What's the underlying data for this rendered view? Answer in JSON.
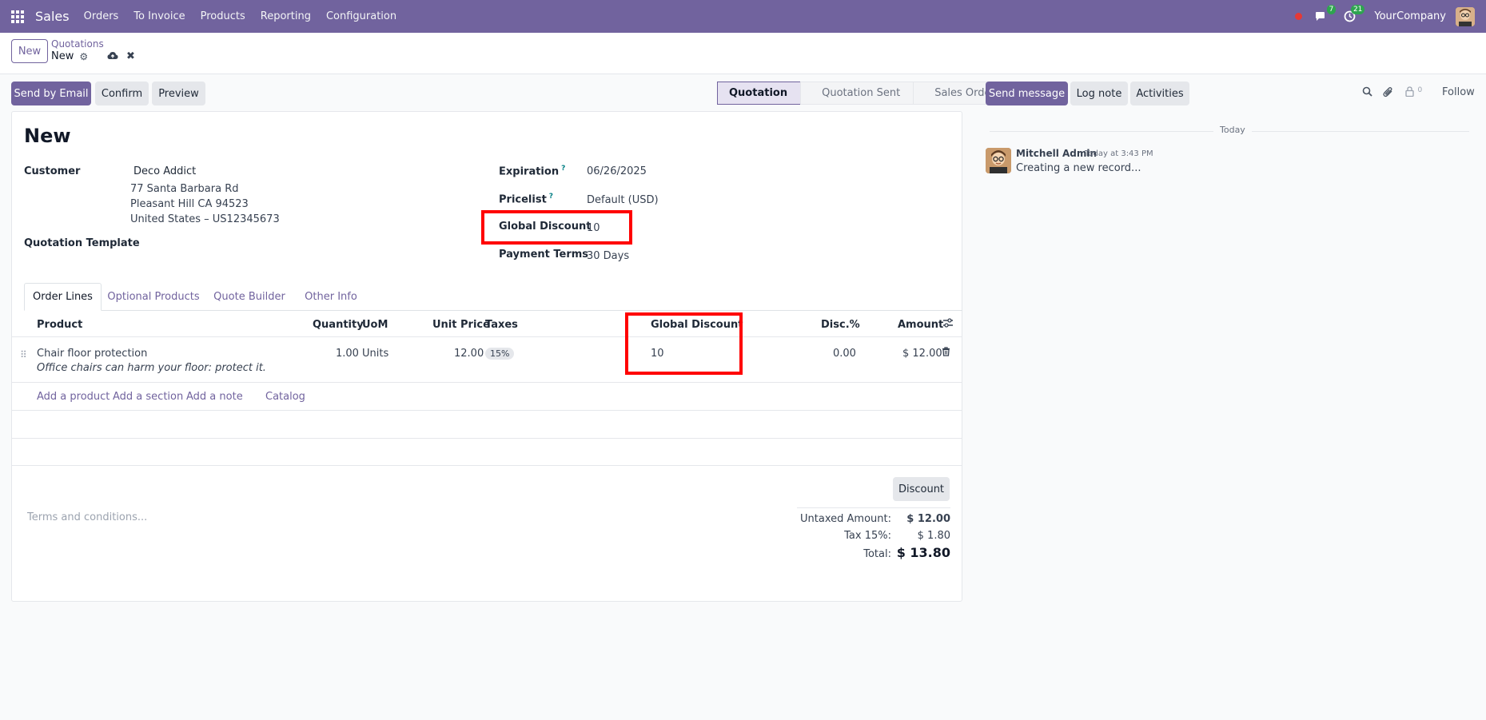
{
  "navbar": {
    "app_name": "Sales",
    "menu": [
      "Orders",
      "To Invoice",
      "Products",
      "Reporting",
      "Configuration"
    ],
    "messages_count": "7",
    "activities_count": "21",
    "company": "YourCompany",
    "color": "#71639e"
  },
  "control": {
    "new_label": "New",
    "breadcrumb_parent": "Quotations",
    "breadcrumb_current": "New"
  },
  "actions": {
    "send_email": "Send by Email",
    "confirm": "Confirm",
    "preview": "Preview"
  },
  "status": {
    "stages": [
      "Quotation",
      "Quotation Sent",
      "Sales Order"
    ],
    "active": "Quotation"
  },
  "form": {
    "title": "New",
    "customer_label": "Customer",
    "customer_name": "Deco Addict",
    "address_line1": "77 Santa Barbara Rd",
    "address_line2": "Pleasant Hill CA 94523",
    "address_line3": "United States – US12345673",
    "template_label": "Quotation Template",
    "expiration_label": "Expiration",
    "expiration_value": "06/26/2025",
    "pricelist_label": "Pricelist",
    "pricelist_value": "Default (USD)",
    "global_discount_label": "Global Discount",
    "global_discount_value": "10",
    "payment_terms_label": "Payment Terms",
    "payment_terms_value": "30 Days",
    "help_mark": "?"
  },
  "tabs": [
    "Order Lines",
    "Optional Products",
    "Quote Builder",
    "Other Info"
  ],
  "table": {
    "headers": {
      "product": "Product",
      "quantity": "Quantity",
      "uom": "UoM",
      "unit_price": "Unit Price",
      "taxes": "Taxes",
      "global_discount": "Global Discount",
      "disc": "Disc.%",
      "amount": "Amount"
    },
    "row": {
      "product": "Chair floor protection",
      "description": "Office chairs can harm your floor: protect it.",
      "quantity": "1.00",
      "uom": "Units",
      "unit_price": "12.00",
      "tax": "15%",
      "global_discount": "10",
      "disc": "0.00",
      "amount": "$ 12.00"
    },
    "links": [
      "Add a product",
      "Add a section",
      "Add a note",
      "Catalog"
    ]
  },
  "footer": {
    "terms_placeholder": "Terms and conditions...",
    "discount_button": "Discount",
    "untaxed_label": "Untaxed Amount:",
    "untaxed_value": "$ 12.00",
    "tax_label": "Tax 15%:",
    "tax_value": "$ 1.80",
    "total_label": "Total:",
    "total_value": "$ 13.80"
  },
  "chatter": {
    "send_message": "Send message",
    "log_note": "Log note",
    "activities": "Activities",
    "followers_count": "0",
    "follow": "Follow",
    "date_separator": "Today",
    "author": "Mitchell Admin",
    "time": "Today at 3:43 PM",
    "body": "Creating a new record..."
  }
}
